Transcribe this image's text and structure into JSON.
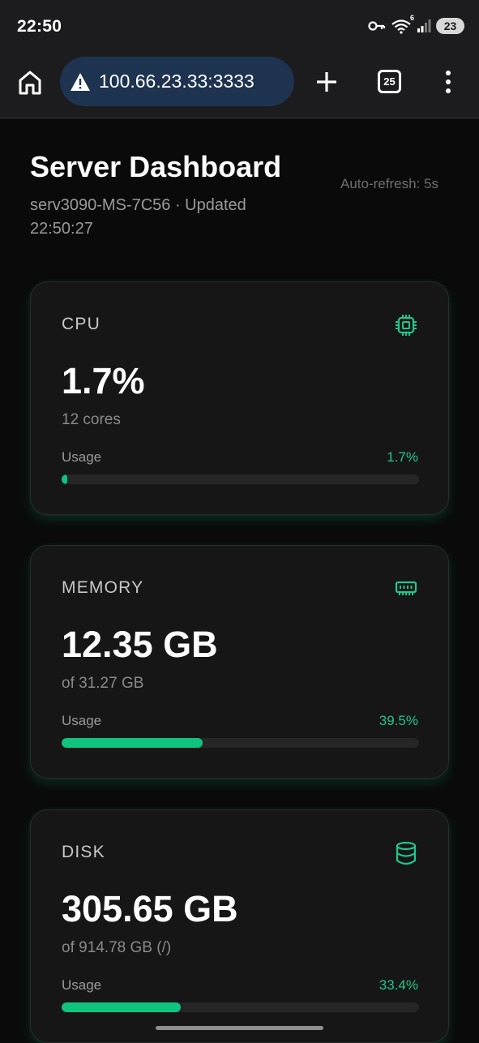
{
  "status": {
    "time": "22:50",
    "network": "6",
    "battery": "23"
  },
  "browser": {
    "url": "100.66.23.33:3333",
    "tab_count": "25"
  },
  "header": {
    "title": "Server Dashboard",
    "subtitle": "serv3090-MS-7C56 · Updated 22:50:27",
    "autorefresh": "Auto-refresh: 5s"
  },
  "cards": [
    {
      "label": "CPU",
      "icon": "cpu-icon",
      "value": "1.7%",
      "sub": "12 cores",
      "usage_label": "Usage",
      "usage_pct_text": "1.7%",
      "usage_pct": 1.7
    },
    {
      "label": "MEMORY",
      "icon": "memory-icon",
      "value": "12.35 GB",
      "sub": "of 31.27 GB",
      "usage_label": "Usage",
      "usage_pct_text": "39.5%",
      "usage_pct": 39.5
    },
    {
      "label": "DISK",
      "icon": "database-icon",
      "value": "305.65 GB",
      "sub": "of 914.78 GB (/)",
      "usage_label": "Usage",
      "usage_pct_text": "33.4%",
      "usage_pct": 33.4
    }
  ],
  "colors": {
    "accent": "#10c47e",
    "accent_text": "#22c58b",
    "url_bar": "#1e3350",
    "card_bg": "#161616"
  }
}
